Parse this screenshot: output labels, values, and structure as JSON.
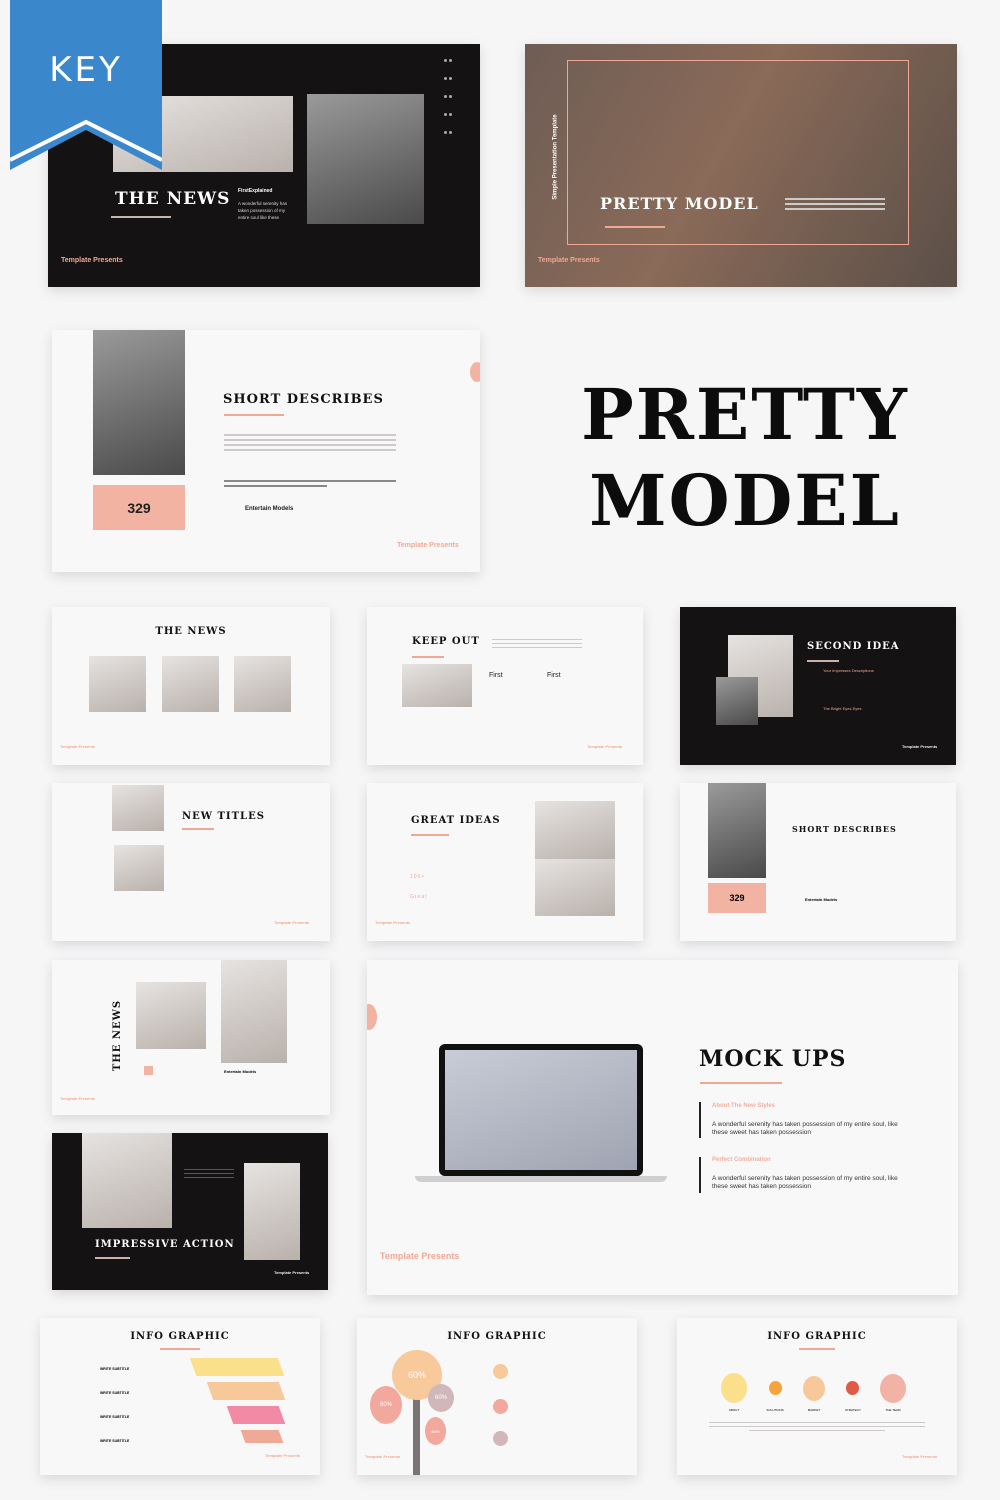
{
  "badge": {
    "label": "KEY",
    "color": "#3b87cc"
  },
  "title": {
    "line1": "PRETTY",
    "line2": "MODEL"
  },
  "accent": "#f0a895",
  "footer_label": "Template Presents",
  "slides": {
    "news_dark": {
      "title": "THE NEWS",
      "subtitle": "FirstExplained",
      "body": "A wonderful serenity has taken possession of my entire soul like these"
    },
    "pretty_model": {
      "title": "PRETTY MODEL",
      "vertical": "Simple Presentation Template"
    },
    "short_describes": {
      "title": "SHORT DESCRIBES",
      "number": "329",
      "link": "Entertain Models"
    },
    "news_grid": {
      "title": "THE NEWS"
    },
    "keep_out": {
      "title": "KEEP OUT",
      "col1": "First",
      "col2": "First"
    },
    "second_idea": {
      "title": "SECOND IDEA",
      "item1": "Your Impresses Descriptions",
      "item2": "The Bright Eyes Eyes"
    },
    "new_titles": {
      "title": "NEW TITLES"
    },
    "great_ideas": {
      "title": "GREAT IDEAS",
      "stat1": "100+",
      "stat2": "Great"
    },
    "short_describes_small": {
      "title": "SHORT DESCRIBES",
      "number": "329",
      "link": "Entertain Models"
    },
    "news_vertical": {
      "title": "THE NEWS",
      "link": "Entertain Models"
    },
    "mock_ups": {
      "title": "MOCK UPS",
      "item1_title": "About The New Styles",
      "item1_body": "A wonderful serenity has taken possession of my entire soul, like these sweet has taken possession",
      "item2_title": "Perfect Combination",
      "item2_body": "A wonderful serenity has taken possession of my entire soul, like these sweet has taken possession"
    },
    "impressive_action": {
      "title": "IMPRESSIVE ACTION"
    },
    "info1": {
      "title": "INFO GRAPHIC",
      "subtitle": "WRITE SUBTITLE",
      "colors": [
        "#fbe08c",
        "#f7c99a",
        "#f28aa6",
        "#efa996"
      ]
    },
    "info2": {
      "title": "INFO GRAPHIC",
      "big": "60%",
      "left": "60%",
      "right": "60%",
      "small": "60%"
    },
    "info3": {
      "title": "INFO GRAPHIC",
      "labels": [
        "ABOUT",
        "SOLUTIONS",
        "MARKET",
        "STRATEGY",
        "THE TEAM"
      ],
      "colors": [
        "#fbe08c",
        "#f5a33c",
        "#f7c99a",
        "#e05a45",
        "#f2b3a6"
      ]
    }
  }
}
